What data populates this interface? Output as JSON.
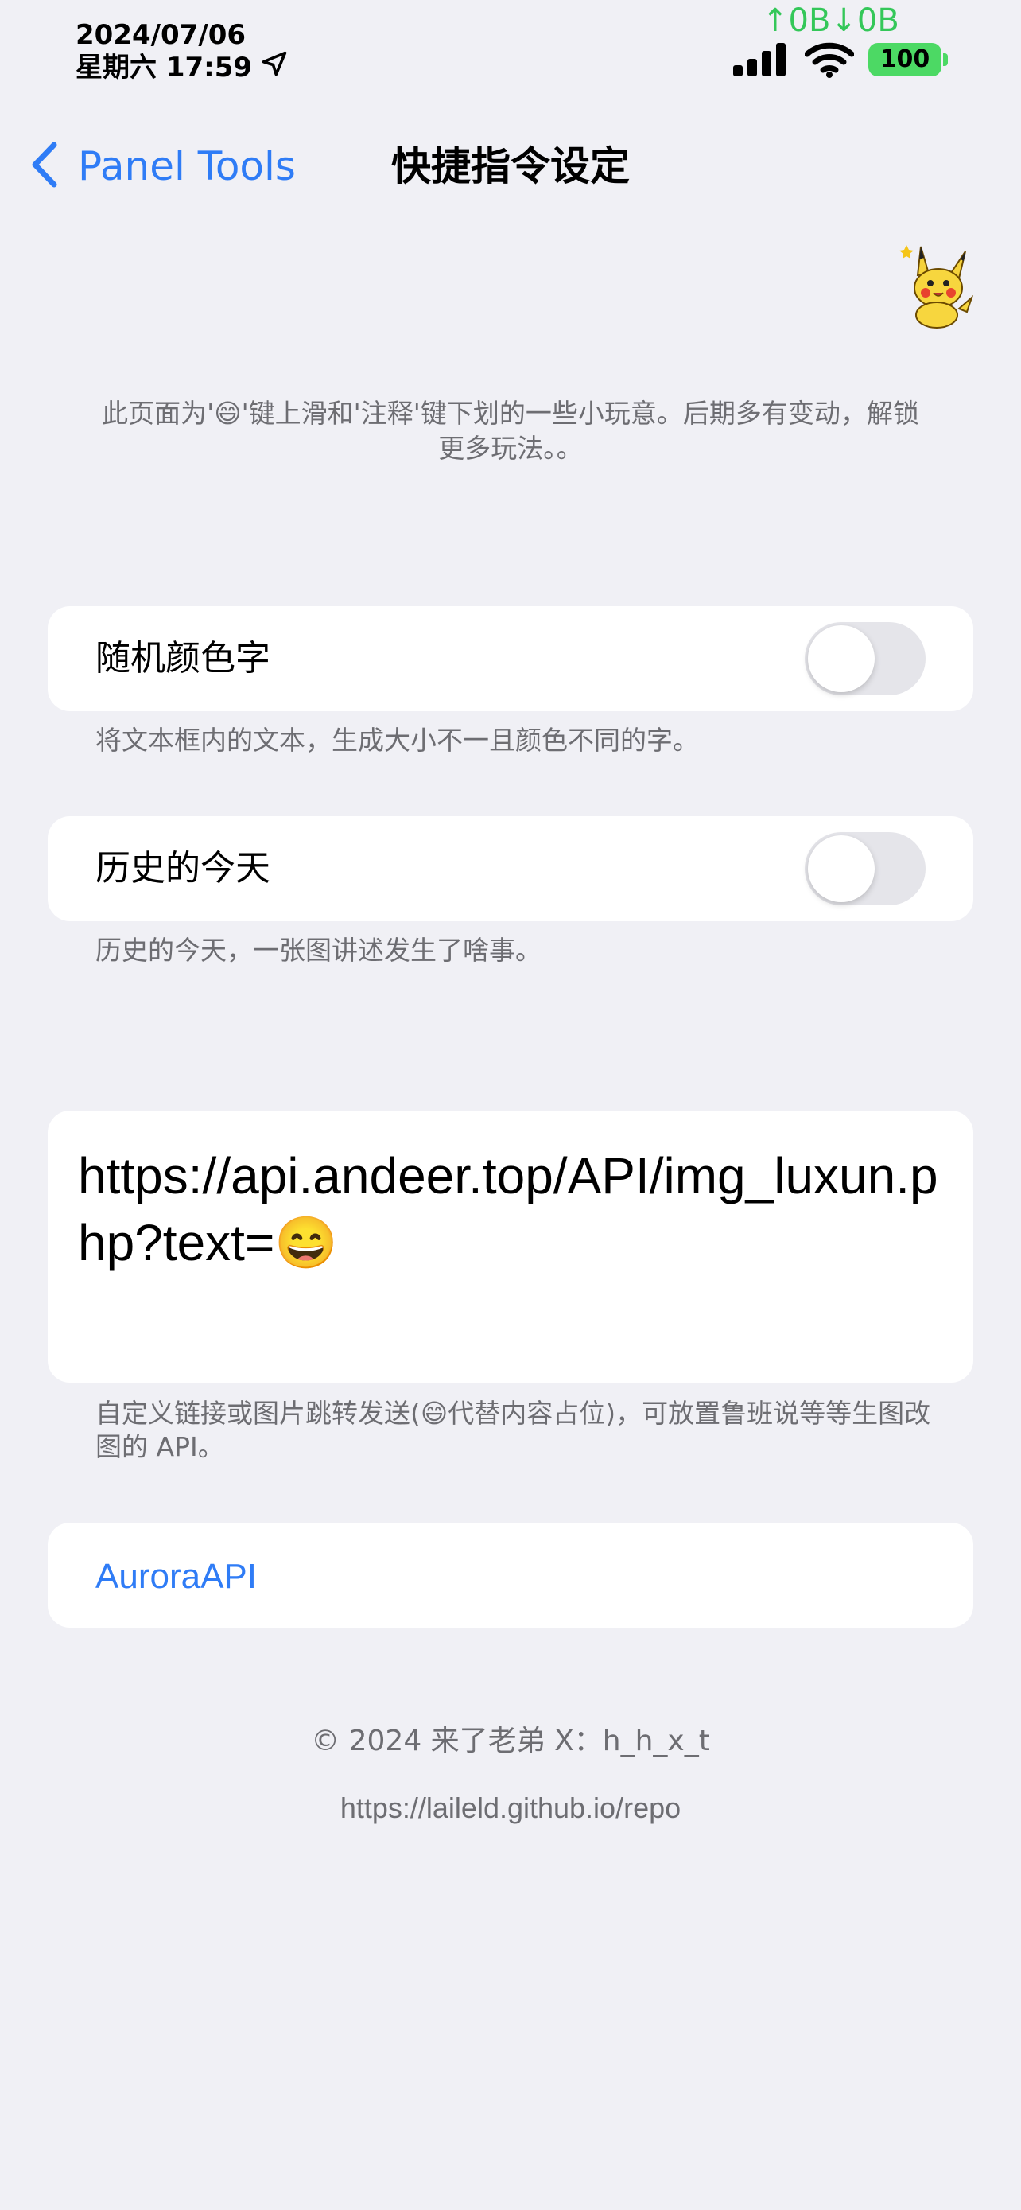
{
  "status_bar": {
    "date": "2024/07/06",
    "weekday_time": "星期六 17:59",
    "network_speed": "↑0B↓0B",
    "battery": "100",
    "accent_green": "#34c759"
  },
  "nav": {
    "back_label": "Panel Tools",
    "title": "快捷指令设定",
    "accent": "#2f7cf6"
  },
  "intro_text": "此页面为'😄'键上滑和'注释'键下划的一些小玩意。后期多有变动，解锁更多玩法。。",
  "settings": [
    {
      "label": "随机颜色字",
      "enabled": false,
      "footnote": "将文本框内的文本，生成大小不一且颜色不同的字。"
    },
    {
      "label": "历史的今天",
      "enabled": false,
      "footnote": "历史的今天，一张图讲述发生了啥事。"
    }
  ],
  "custom_url": {
    "value": "https://api.andeer.top/API/img_luxun.php?text=😄",
    "footnote": "自定义链接或图片跳转发送(😄代替内容占位)，可放置鲁班说等等生图改图的 API。"
  },
  "api_link": {
    "label": "AuroraAPI"
  },
  "footer": {
    "copyright": "© 2024  来了老弟  X：h_h_x_t",
    "repo_url": "https://laileld.github.io/repo"
  },
  "icons": {
    "back": "chevron-left-icon",
    "location": "location-arrow-icon",
    "signal": "cellular-signal-icon",
    "wifi": "wifi-icon",
    "mascot": "pikachu-icon"
  }
}
